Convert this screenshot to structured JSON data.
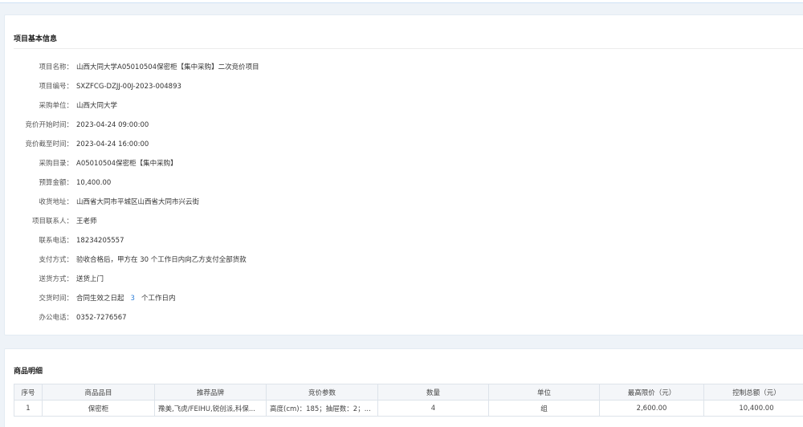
{
  "info": {
    "title": "项目基本信息",
    "fields": [
      {
        "label": "项目名称：",
        "value": "山西大同大学A05010504保密柜【集中采购】二次竞价项目"
      },
      {
        "label": "项目编号：",
        "value": "SXZFCG-DZJJ-00J-2023-004893"
      },
      {
        "label": "采购单位：",
        "value": "山西大同大学"
      },
      {
        "label": "竞价开始时间：",
        "value": "2023-04-24 09:00:00"
      },
      {
        "label": "竞价截至时间：",
        "value": "2023-04-24 16:00:00"
      },
      {
        "label": "采购目录：",
        "value": "A05010504保密柜【集中采购】"
      },
      {
        "label": "预算金额：",
        "value": "10,400.00"
      },
      {
        "label": "收货地址：",
        "value": "山西省大同市平城区山西省大同市兴云街"
      },
      {
        "label": "项目联系人：",
        "value": "王老师"
      },
      {
        "label": "联系电话：",
        "value": "18234205557"
      },
      {
        "label": "支付方式：",
        "value": "验收合格后，甲方在 30 个工作日内向乙方支付全部货款"
      },
      {
        "label": "送货方式：",
        "value": "送货上门"
      },
      {
        "label": "交货时间：",
        "value_prefix": "合同生效之日起",
        "value_highlight": "3",
        "value_suffix": "个工作日内"
      },
      {
        "label": "办公电话：",
        "value": "0352-7276567"
      }
    ]
  },
  "goods": {
    "title": "商品明细",
    "columns": [
      "序号",
      "商品品目",
      "推荐品牌",
      "竞价参数",
      "数量",
      "单位",
      "最高限价（元）",
      "控制总额（元）"
    ],
    "rows": [
      [
        "1",
        "保密柜",
        "豫美,飞虎/FEIHU,锐创派,科保...",
        "高度(cm)：185；抽屉数：2；...",
        "4",
        "组",
        "2,600.00",
        "10,400.00"
      ]
    ]
  }
}
